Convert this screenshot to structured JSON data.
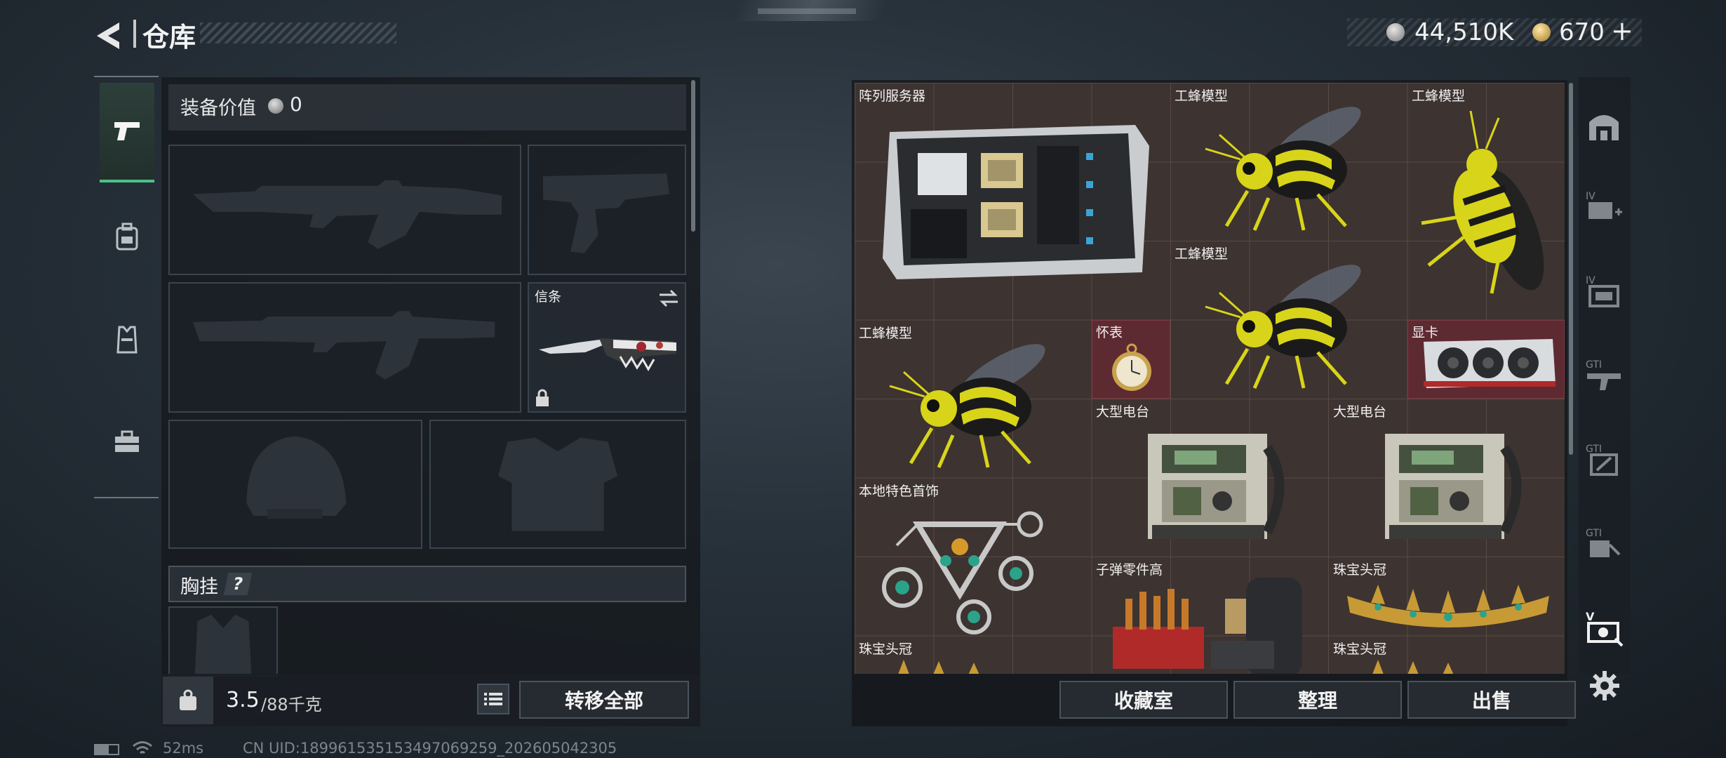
{
  "header": {
    "title": "仓库",
    "currency_silver": "44,510K",
    "currency_gold": "670",
    "gold_add": "+"
  },
  "left_tabs": [
    "pistol-icon",
    "backpack-icon",
    "vest-icon",
    "toolbox-icon"
  ],
  "equipment": {
    "value_label": "装备价值",
    "value": "0",
    "knife_label": "信条",
    "chest_rig_label": "胸挂",
    "help": "?"
  },
  "inventory": {
    "weight": "3.5",
    "weight_max": "/88千克",
    "transfer_all": "转移全部"
  },
  "stash_items": [
    {
      "name": "阵列服务器"
    },
    {
      "name": "工蜂模型"
    },
    {
      "name": "工蜂模型"
    },
    {
      "name": "工蜂模型"
    },
    {
      "name": "工蜂模型"
    },
    {
      "name": "怀表"
    },
    {
      "name": "显卡"
    },
    {
      "name": "大型电台"
    },
    {
      "name": "大型电台"
    },
    {
      "name": "本地特色首饰"
    },
    {
      "name": "子弹零件高"
    },
    {
      "name": "珠宝头冠"
    },
    {
      "name": "珠宝头冠"
    },
    {
      "name": "珠宝头冠"
    }
  ],
  "bottom_buttons": {
    "collection": "收藏室",
    "sort": "整理",
    "sell": "出售"
  },
  "right_tabs": [
    "garage-icon",
    "iv-medkit-icon",
    "iv-ammo-icon",
    "gti-weapon-icon",
    "gti-armor-icon",
    "gti-misc-icon",
    "v-special-icon"
  ],
  "status": {
    "ping": "52ms",
    "uid": "CN UID:18996153515349706925​9_202605042305"
  },
  "colors": {
    "grid_bg": "#3d3330",
    "grid_line": "#5a4a44",
    "highlight_red": "#5e2a31",
    "accent_green": "#4fbf8a"
  }
}
